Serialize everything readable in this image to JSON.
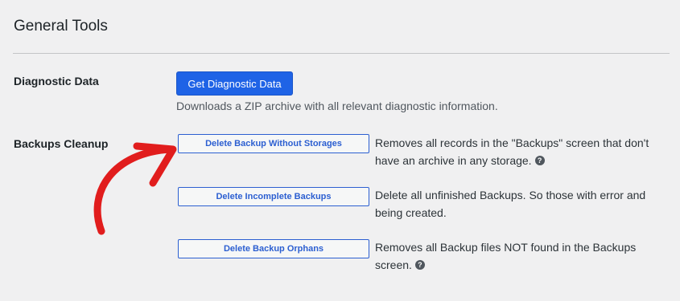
{
  "page": {
    "title": "General Tools"
  },
  "diagnostic": {
    "label": "Diagnostic Data",
    "button_label": "Get Diagnostic Data",
    "hint": "Downloads a ZIP archive with all relevant diagnostic information."
  },
  "cleanup": {
    "label": "Backups Cleanup",
    "actions": [
      {
        "button_label": "Delete Backup Without Storages",
        "description": "Removes all records in the \"Backups\" screen that don't have an archive in any storage.",
        "has_help": true
      },
      {
        "button_label": "Delete Incomplete Backups",
        "description": "Delete all unfinished Backups. So those with error and being created.",
        "has_help": false
      },
      {
        "button_label": "Delete Backup Orphans",
        "description": "Removes all Backup files NOT found in the Backups screen.",
        "has_help": true
      }
    ]
  },
  "icons": {
    "help": "question-circle-icon",
    "annotation": "red-arrow-annotation"
  },
  "colors": {
    "primary_button": "#1f63e6",
    "secondary_border": "#2c5fd1",
    "annotation_red": "#e11d1d",
    "background": "#f0f0f1"
  }
}
